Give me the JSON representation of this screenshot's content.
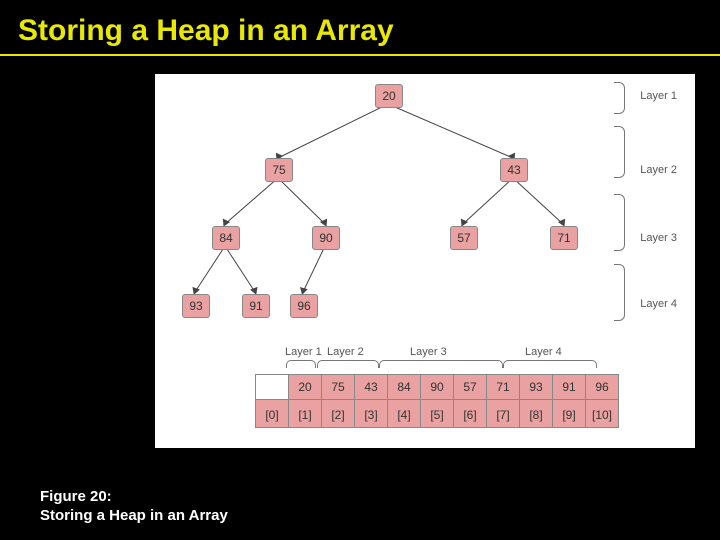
{
  "title": "Storing a Heap in an Array",
  "caption_line1": "Figure 20:",
  "caption_line2": "Storing a Heap in an Array",
  "layers": {
    "l1": "Layer 1",
    "l2": "Layer 2",
    "l3": "Layer 3",
    "l4": "Layer 4"
  },
  "tree": {
    "n0": "20",
    "n1": "75",
    "n2": "43",
    "n3": "84",
    "n4": "90",
    "n5": "57",
    "n6": "71",
    "n7": "93",
    "n8": "91",
    "n9": "96"
  },
  "chart_data": {
    "type": "table",
    "title": "Storing a Heap in an Array",
    "heap_tree": {
      "layers": [
        {
          "label": "Layer 1",
          "nodes": [
            20
          ]
        },
        {
          "label": "Layer 2",
          "nodes": [
            75,
            43
          ]
        },
        {
          "label": "Layer 3",
          "nodes": [
            84,
            90,
            57,
            71
          ]
        },
        {
          "label": "Layer 4",
          "nodes": [
            93,
            91,
            96
          ]
        }
      ],
      "edges": [
        [
          20,
          75
        ],
        [
          20,
          43
        ],
        [
          75,
          84
        ],
        [
          75,
          90
        ],
        [
          43,
          57
        ],
        [
          43,
          71
        ],
        [
          84,
          93
        ],
        [
          84,
          91
        ],
        [
          90,
          96
        ]
      ]
    },
    "array": {
      "indices": [
        "[0]",
        "[1]",
        "[2]",
        "[3]",
        "[4]",
        "[5]",
        "[6]",
        "[7]",
        "[8]",
        "[9]",
        "[10]"
      ],
      "values": [
        "",
        "20",
        "75",
        "43",
        "84",
        "90",
        "57",
        "71",
        "93",
        "91",
        "96"
      ],
      "groups": [
        {
          "label": "Layer 1",
          "span": [
            1,
            1
          ]
        },
        {
          "label": "Layer 2",
          "span": [
            2,
            3
          ]
        },
        {
          "label": "Layer 3",
          "span": [
            4,
            7
          ]
        },
        {
          "label": "Layer 4",
          "span": [
            8,
            10
          ]
        }
      ]
    }
  },
  "array": {
    "v0": "",
    "v1": "20",
    "v2": "75",
    "v3": "43",
    "v4": "84",
    "v5": "90",
    "v6": "57",
    "v7": "71",
    "v8": "93",
    "v9": "91",
    "v10": "96",
    "i0": "[0]",
    "i1": "[1]",
    "i2": "[2]",
    "i3": "[3]",
    "i4": "[4]",
    "i5": "[5]",
    "i6": "[6]",
    "i7": "[7]",
    "i8": "[8]",
    "i9": "[9]",
    "i10": "[10]"
  },
  "grp": {
    "g1": "Layer 1",
    "g2": "Layer 2",
    "g3": "Layer 3",
    "g4": "Layer 4"
  }
}
